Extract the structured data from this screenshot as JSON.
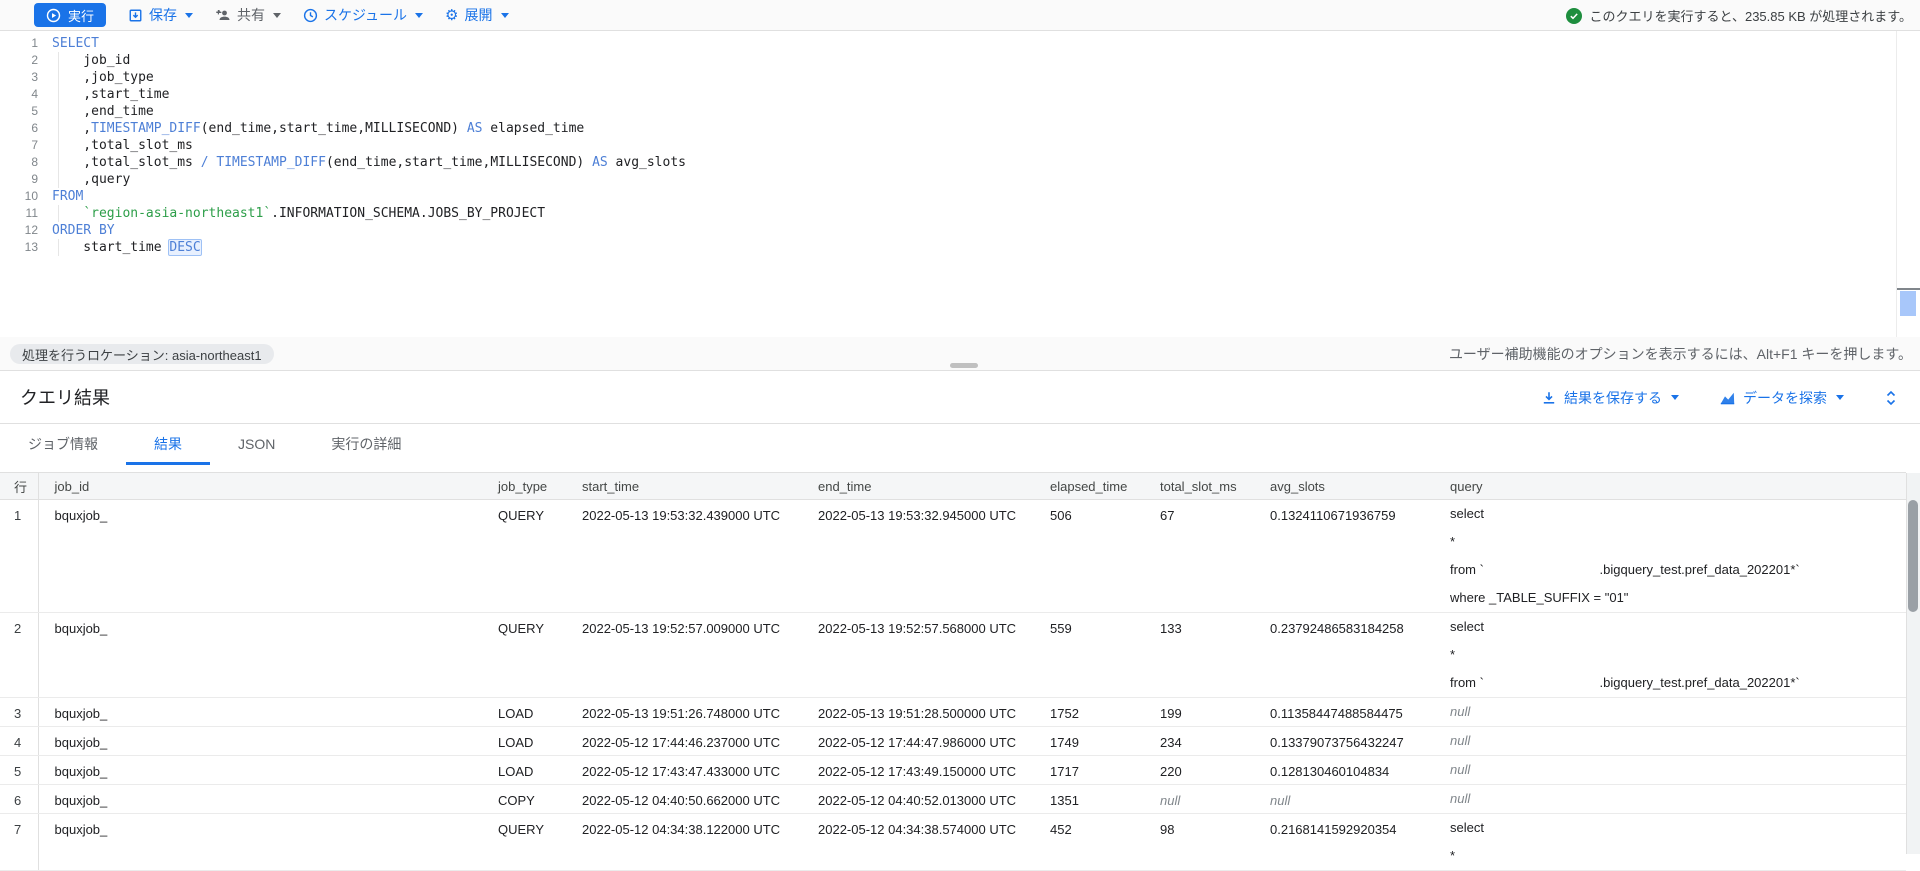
{
  "colors": {
    "accent_blue": "#1a73e8",
    "keyword_blue": "#4d7fd6",
    "string_green": "#2d9e49",
    "success_green": "#1e8e3e",
    "muted_gray": "#5f6368"
  },
  "toolbar": {
    "run_label": "実行",
    "save_label": "保存",
    "share_label": "共有",
    "schedule_label": "スケジュール",
    "expand_label": "展開",
    "process_message": "このクエリを実行すると、235.85 KB が処理されます。"
  },
  "editor": {
    "lines": [
      {
        "num": "1",
        "indent": false,
        "tokens": [
          {
            "c": "k",
            "t": "SELECT"
          }
        ]
      },
      {
        "num": "2",
        "indent": true,
        "tokens": [
          {
            "c": "t",
            "t": "    job_id"
          }
        ]
      },
      {
        "num": "3",
        "indent": true,
        "tokens": [
          {
            "c": "t",
            "t": "    ,job_type"
          }
        ]
      },
      {
        "num": "4",
        "indent": true,
        "tokens": [
          {
            "c": "t",
            "t": "    ,start_time"
          }
        ]
      },
      {
        "num": "5",
        "indent": true,
        "tokens": [
          {
            "c": "t",
            "t": "    ,end_time"
          }
        ]
      },
      {
        "num": "6",
        "indent": true,
        "tokens": [
          {
            "c": "t",
            "t": "    ,"
          },
          {
            "c": "k",
            "t": "TIMESTAMP_DIFF"
          },
          {
            "c": "t",
            "t": "(end_time,start_time,MILLISECOND) "
          },
          {
            "c": "k",
            "t": "AS"
          },
          {
            "c": "t",
            "t": " elapsed_time"
          }
        ]
      },
      {
        "num": "7",
        "indent": true,
        "tokens": [
          {
            "c": "t",
            "t": "    ,total_slot_ms"
          }
        ]
      },
      {
        "num": "8",
        "indent": true,
        "tokens": [
          {
            "c": "t",
            "t": "    ,total_slot_ms "
          },
          {
            "c": "k",
            "t": "/"
          },
          {
            "c": "t",
            "t": " "
          },
          {
            "c": "k",
            "t": "TIMESTAMP_DIFF"
          },
          {
            "c": "t",
            "t": "(end_time,start_time,MILLISECOND) "
          },
          {
            "c": "k",
            "t": "AS"
          },
          {
            "c": "t",
            "t": " avg_slots"
          }
        ]
      },
      {
        "num": "9",
        "indent": true,
        "tokens": [
          {
            "c": "t",
            "t": "    ,query"
          }
        ]
      },
      {
        "num": "10",
        "indent": false,
        "tokens": [
          {
            "c": "k",
            "t": "FROM"
          }
        ]
      },
      {
        "num": "11",
        "indent": true,
        "tokens": [
          {
            "c": "t",
            "t": "    "
          },
          {
            "c": "s",
            "t": "`region-asia-northeast1`"
          },
          {
            "c": "t",
            "t": ".INFORMATION_SCHEMA.JOBS_BY_PROJECT"
          }
        ]
      },
      {
        "num": "12",
        "indent": false,
        "tokens": [
          {
            "c": "k",
            "t": "ORDER BY"
          }
        ]
      },
      {
        "num": "13",
        "indent": true,
        "tokens": [
          {
            "c": "t",
            "t": "    start_time "
          },
          {
            "c": "sel",
            "t": "DESC"
          }
        ]
      }
    ]
  },
  "statusbar": {
    "location_chip": "処理を行うロケーション: asia-northeast1",
    "accessibility_hint": "ユーザー補助機能のオプションを表示するには、Alt+F1 キーを押します。"
  },
  "results": {
    "title": "クエリ結果",
    "save_results_label": "結果を保存する",
    "explore_data_label": "データを探索",
    "tabs": [
      {
        "label": "ジョブ情報",
        "active": false
      },
      {
        "label": "結果",
        "active": true
      },
      {
        "label": "JSON",
        "active": false
      },
      {
        "label": "実行の詳細",
        "active": false
      }
    ],
    "table": {
      "null_display": "null",
      "columns": [
        "行",
        "job_id",
        "job_type",
        "start_time",
        "end_time",
        "elapsed_time",
        "total_slot_ms",
        "avg_slots",
        "query"
      ],
      "rows": [
        {
          "num": "1",
          "job_id": "bquxjob_",
          "job_type": "QUERY",
          "start_time": "2022-05-13 19:53:32.439000 UTC",
          "end_time": "2022-05-13 19:53:32.945000 UTC",
          "elapsed_time": "506",
          "total_slot_ms": "67",
          "avg_slots": "0.1324110671936759",
          "query": [
            "select",
            "*",
            "from `                                .bigquery_test.pref_data_202201*`",
            "where _TABLE_SUFFIX = \"01\""
          ]
        },
        {
          "num": "2",
          "job_id": "bquxjob_",
          "job_type": "QUERY",
          "start_time": "2022-05-13 19:52:57.009000 UTC",
          "end_time": "2022-05-13 19:52:57.568000 UTC",
          "elapsed_time": "559",
          "total_slot_ms": "133",
          "avg_slots": "0.23792486583184258",
          "query": [
            "select",
            "*",
            "from `                                .bigquery_test.pref_data_202201*`"
          ]
        },
        {
          "num": "3",
          "job_id": "bquxjob_",
          "job_type": "LOAD",
          "start_time": "2022-05-13 19:51:26.748000 UTC",
          "end_time": "2022-05-13 19:51:28.500000 UTC",
          "elapsed_time": "1752",
          "total_slot_ms": "199",
          "avg_slots": "0.11358447488584475",
          "query": null
        },
        {
          "num": "4",
          "job_id": "bquxjob_",
          "job_type": "LOAD",
          "start_time": "2022-05-12 17:44:46.237000 UTC",
          "end_time": "2022-05-12 17:44:47.986000 UTC",
          "elapsed_time": "1749",
          "total_slot_ms": "234",
          "avg_slots": "0.13379073756432247",
          "query": null
        },
        {
          "num": "5",
          "job_id": "bquxjob_",
          "job_type": "LOAD",
          "start_time": "2022-05-12 17:43:47.433000 UTC",
          "end_time": "2022-05-12 17:43:49.150000 UTC",
          "elapsed_time": "1717",
          "total_slot_ms": "220",
          "avg_slots": "0.128130460104834",
          "query": null
        },
        {
          "num": "6",
          "job_id": "bquxjob_",
          "job_type": "COPY",
          "start_time": "2022-05-12 04:40:50.662000 UTC",
          "end_time": "2022-05-12 04:40:52.013000 UTC",
          "elapsed_time": "1351",
          "total_slot_ms": null,
          "avg_slots": null,
          "query": null
        },
        {
          "num": "7",
          "job_id": "bquxjob_",
          "job_type": "QUERY",
          "start_time": "2022-05-12 04:34:38.122000 UTC",
          "end_time": "2022-05-12 04:34:38.574000 UTC",
          "elapsed_time": "452",
          "total_slot_ms": "98",
          "avg_slots": "0.2168141592920354",
          "query": [
            "select",
            "*"
          ]
        }
      ]
    }
  }
}
